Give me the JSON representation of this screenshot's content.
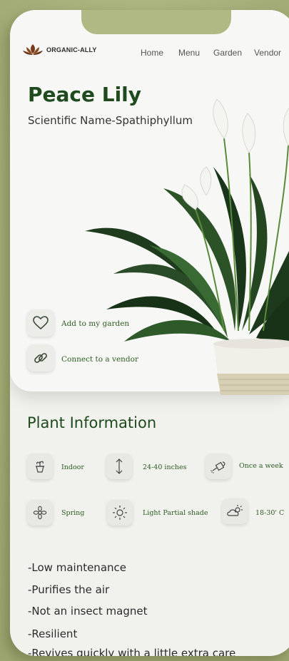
{
  "brand": {
    "name": "ORGANIC-ALLY",
    "logo_icon": "lotus-logo-icon"
  },
  "nav": {
    "items": [
      {
        "label": "Home"
      },
      {
        "label": "Menu"
      },
      {
        "label": "Garden"
      },
      {
        "label": "Vendor"
      }
    ]
  },
  "plant": {
    "name": "Peace Lily",
    "scientific": "Scientific Name-Spathiphyllum",
    "image": "peace-lily-plant-in-pot"
  },
  "actions": [
    {
      "label": "Add to my garden",
      "icon": "heart-icon"
    },
    {
      "label": "Connect to a vendor",
      "icon": "link-icon"
    }
  ],
  "info": {
    "title": "Plant Information",
    "items": [
      {
        "label": "Indoor",
        "icon": "potted-plant-icon"
      },
      {
        "label": "24-40 inches",
        "icon": "height-arrow-icon"
      },
      {
        "label": "Once a week",
        "icon": "watering-can-icon"
      },
      {
        "label": "Spring",
        "icon": "flower-icon"
      },
      {
        "label": "Light Partial shade",
        "icon": "sun-icon"
      },
      {
        "label": "18-30' C",
        "icon": "cloud-sun-icon"
      }
    ]
  },
  "features": [
    "-Low maintenance",
    "-Purifies the air",
    "-Not an insect magnet",
    "-Resilient",
    "-Revives quickly with a little extra care"
  ],
  "colors": {
    "accent": "#1f4a1d",
    "background": "#a9b27c",
    "card": "#f7f7f5"
  }
}
